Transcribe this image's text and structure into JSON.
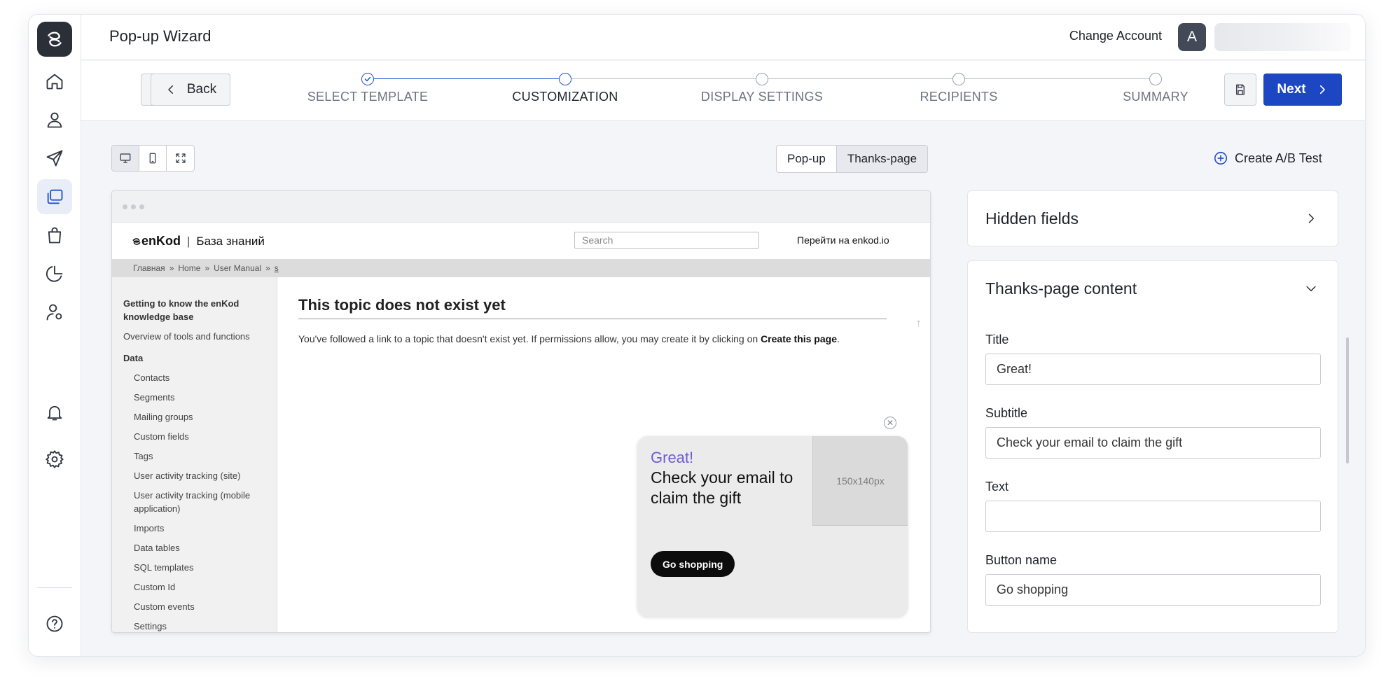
{
  "header": {
    "title": "Pop-up Wizard",
    "change_account": "Change Account",
    "avatar_letter": "A"
  },
  "nav": {
    "items": [
      "home-icon",
      "contacts-icon",
      "send-icon",
      "popups-icon",
      "shop-icon",
      "analytics-icon",
      "user-settings-icon",
      "bell-icon",
      "gear-icon",
      "help-icon"
    ],
    "active": "popups-icon"
  },
  "wizard": {
    "back_label": "Back",
    "next_label": "Next",
    "steps": [
      {
        "label": "SELECT TEMPLATE",
        "state": "done"
      },
      {
        "label": "CUSTOMIZATION",
        "state": "current"
      },
      {
        "label": "DISPLAY SETTINGS",
        "state": "pending"
      },
      {
        "label": "RECIPIENTS",
        "state": "pending"
      },
      {
        "label": "SUMMARY",
        "state": "pending"
      }
    ]
  },
  "toolbar": {
    "device_views": [
      "desktop-icon",
      "mobile-icon",
      "fullscreen-icon"
    ],
    "tabs": [
      "Pop-up",
      "Thanks-page"
    ],
    "active_tab": "Thanks-page",
    "ab_test_label": "Create A/B Test"
  },
  "preview": {
    "site": {
      "brand": "enKod",
      "section": "База знаний",
      "search_placeholder": "Search",
      "goto_link": "Перейти на enkod.io",
      "breadcrumbs": [
        "Главная",
        "»",
        "Home",
        "»",
        "User Manual",
        "»",
        "s"
      ]
    },
    "sidebar": [
      {
        "text": "Getting to know the enKod knowledge base",
        "style": "bold"
      },
      {
        "text": "Overview of tools and functions",
        "style": "normal"
      },
      {
        "text": "Data",
        "style": "bold"
      },
      {
        "text": "Contacts",
        "style": "sub"
      },
      {
        "text": "Segments",
        "style": "sub"
      },
      {
        "text": "Mailing groups",
        "style": "sub"
      },
      {
        "text": "Custom fields",
        "style": "sub"
      },
      {
        "text": "Tags",
        "style": "sub"
      },
      {
        "text": "User activity tracking (site)",
        "style": "sub"
      },
      {
        "text": "User activity tracking (mobile application)",
        "style": "sub"
      },
      {
        "text": "Imports",
        "style": "sub"
      },
      {
        "text": "Data tables",
        "style": "sub"
      },
      {
        "text": "SQL templates",
        "style": "sub"
      },
      {
        "text": "Custom Id",
        "style": "sub"
      },
      {
        "text": "Custom events",
        "style": "sub"
      },
      {
        "text": "Settings",
        "style": "sub"
      }
    ],
    "heading": "This topic does not exist yet",
    "paragraph": "You've followed a link to a topic that doesn't exist yet. If permissions allow, you may create it by clicking on ",
    "paragraph_link": "Create this page",
    "paragraph_end": ".",
    "popup": {
      "title": "Great!",
      "subtitle": "Check your email to claim the gift",
      "button": "Go shopping",
      "image_placeholder": "150x140px",
      "title_color": "#6f5bd6"
    }
  },
  "panels": {
    "hidden_fields": {
      "title": "Hidden fields"
    },
    "thanks_content": {
      "title": "Thanks-page content",
      "fields": [
        {
          "label": "Title",
          "value": "Great!"
        },
        {
          "label": "Subtitle",
          "value": "Check your email to claim the gift"
        },
        {
          "label": "Text",
          "value": ""
        },
        {
          "label": "Button name",
          "value": "Go shopping"
        }
      ]
    }
  },
  "colors": {
    "accent": "#1d46c2",
    "nav_active_bg": "#e9edf8",
    "popup_button": "#0c0c0c"
  }
}
